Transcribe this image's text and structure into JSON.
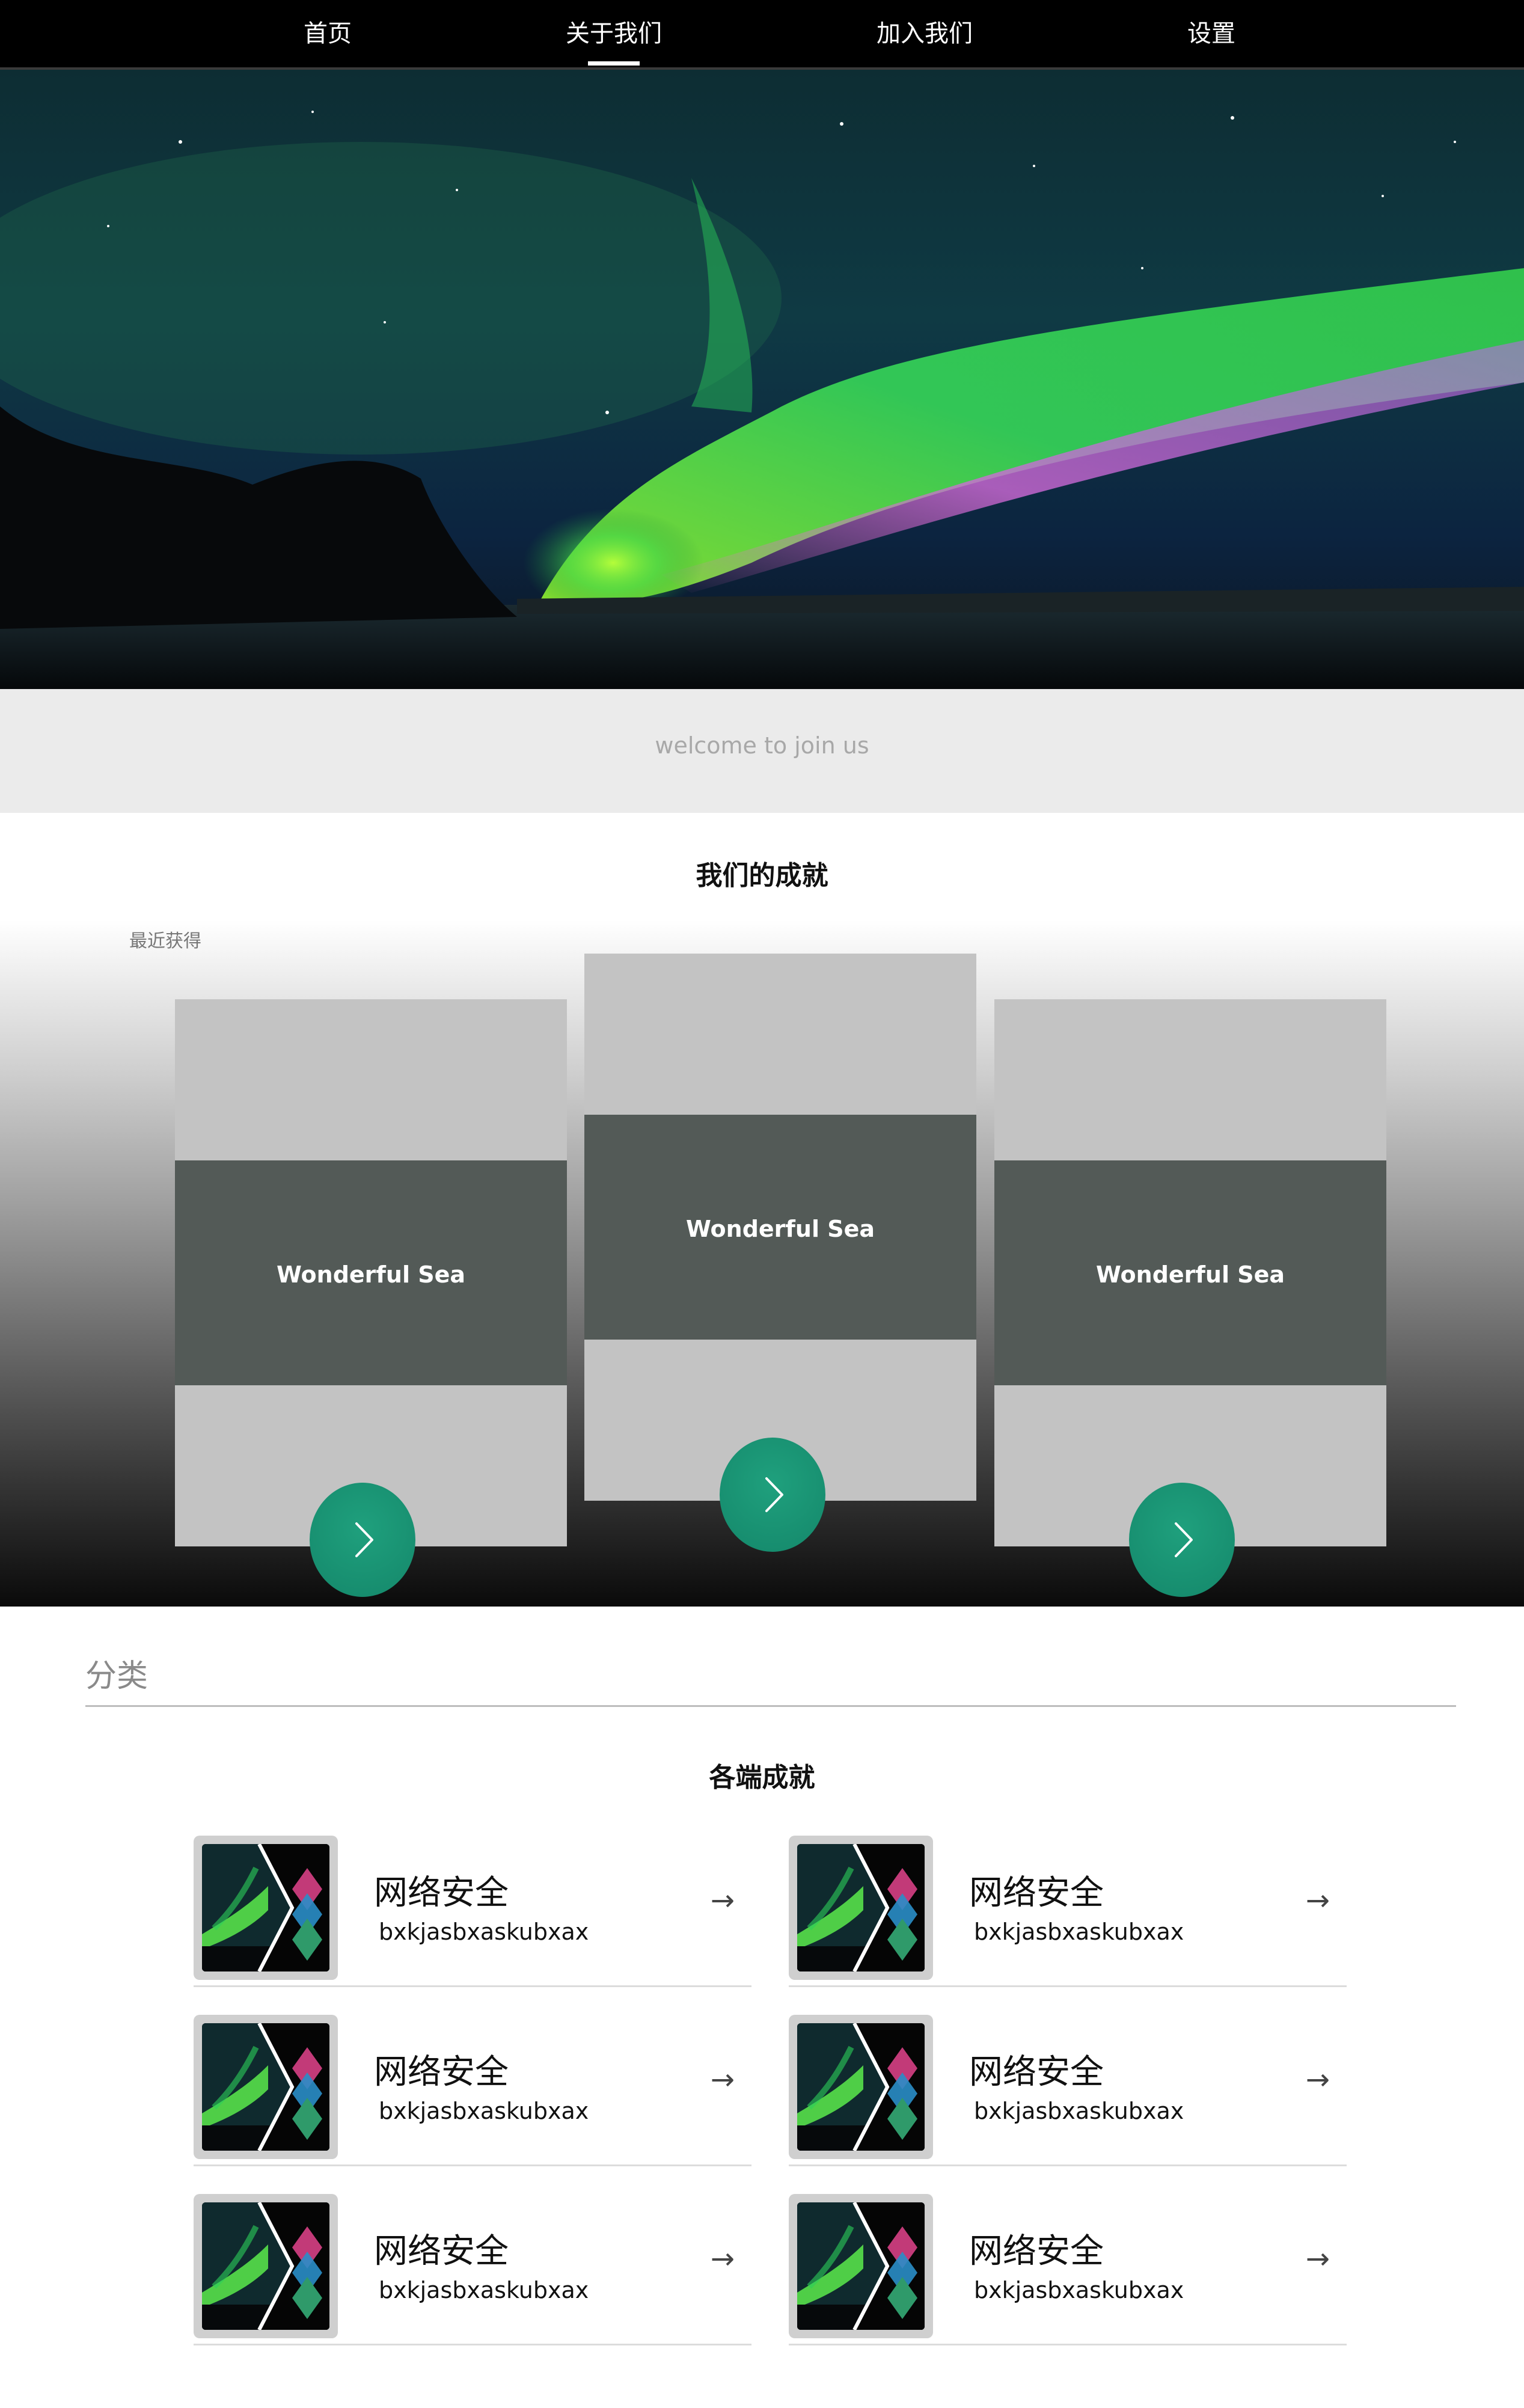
{
  "nav": {
    "items": [
      {
        "label": "首页"
      },
      {
        "label": "关于我们",
        "active": true
      },
      {
        "label": "加入我们"
      },
      {
        "label": "设置"
      }
    ]
  },
  "hero": {
    "image": "aurora-night-sky"
  },
  "welcome": {
    "text": "welcome to join us"
  },
  "achievements": {
    "title": "我们的成就",
    "label": "最近获得",
    "cards": [
      {
        "title": "Wonderful Sea"
      },
      {
        "title": "Wonderful Sea"
      },
      {
        "title": "Wonderful Sea"
      }
    ],
    "button_icon": "chevron-right-icon"
  },
  "categories": {
    "heading": "分类",
    "subtitle": "各端成就",
    "items": [
      {
        "title": "网络安全",
        "subtitle": "bxkjasbxaskubxax",
        "arrow": "→"
      },
      {
        "title": "网络安全",
        "subtitle": "bxkjasbxaskubxax",
        "arrow": "→"
      },
      {
        "title": "网络安全",
        "subtitle": "bxkjasbxaskubxax",
        "arrow": "→"
      },
      {
        "title": "网络安全",
        "subtitle": "bxkjasbxaskubxax",
        "arrow": "→"
      },
      {
        "title": "网络安全",
        "subtitle": "bxkjasbxaskubxax",
        "arrow": "→"
      },
      {
        "title": "网络安全",
        "subtitle": "bxkjasbxaskubxax",
        "arrow": "→"
      }
    ]
  },
  "colors": {
    "nav_bg": "#000000",
    "accent_button": "#14876a",
    "card_bg": "#c3c3c3",
    "card_band": "#535a57",
    "welcome_band": "#ebebeb"
  }
}
